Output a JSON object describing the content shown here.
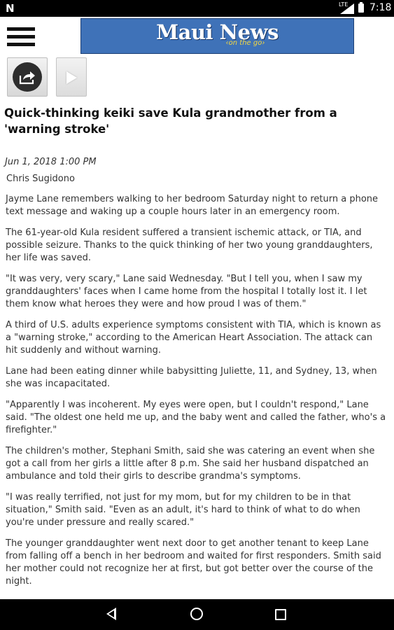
{
  "status_bar": {
    "notification_icon": "n-icon",
    "network_label": "LTE",
    "time": "7:18"
  },
  "app_bar": {
    "menu_icon": "hamburger-icon",
    "logo_title": "Maui News",
    "logo_subtitle": "on the go",
    "logo_color": "#3f72b8",
    "logo_subtitle_color": "#f3d742"
  },
  "toolbar": {
    "share_icon": "share-icon",
    "play_icon": "play-icon"
  },
  "article": {
    "headline": "Quick-thinking keiki save Kula grandmother from a 'warning stroke'",
    "date": "Jun 1, 2018 1:00 PM",
    "author": "Chris Sugidono",
    "paragraphs": [
      "Jayme Lane remembers walking to her bedroom Saturday night to return a phone text message and waking up a couple hours later in an emergency room.",
      "The 61-year-old Kula resident suffered a transient ischemic attack, or TIA, and possible seizure. Thanks to the quick thinking of her two young granddaughters, her life was saved.",
      "\"It was very, very scary,\" Lane said Wednesday. \"But I tell you, when I saw my granddaughters' faces when I came home from the hospital I totally lost it. I let them know what heroes they were and how proud I was of them.\"",
      "A third of U.S. adults experience symptoms consistent with TIA, which is known as a \"warning stroke,\" according to the American Heart Association. The attack can hit suddenly and without warning.",
      "Lane had been eating dinner while babysitting Juliette, 11, and Sydney, 13, when she was incapacitated.",
      "\"Apparently I was incoherent. My eyes were open, but I couldn't respond,\" Lane said. \"The oldest one held me up, and the baby went and called the father, who's a firefighter.\"",
      "The children's mother, Stephani Smith, said she was catering an event when she got a call from her girls a little after 8 p.m. She said her husband dispatched an ambulance and told their girls to describe grandma's symptoms.",
      "\"I was really terrified, not just for my mom, but for my children to be in that situation,\" Smith said. \"Even as an adult, it's hard to think of what to do when you're under pressure and really scared.\"",
      "The younger granddaughter went next door to get another tenant to keep Lane from falling off a bench in her bedroom and waited for first responders. Smith said her mother could not recognize her at first, but got better over the course of the night."
    ]
  },
  "nav_bar": {
    "back_icon": "back-icon",
    "home_icon": "home-icon",
    "recents_icon": "recents-icon"
  }
}
